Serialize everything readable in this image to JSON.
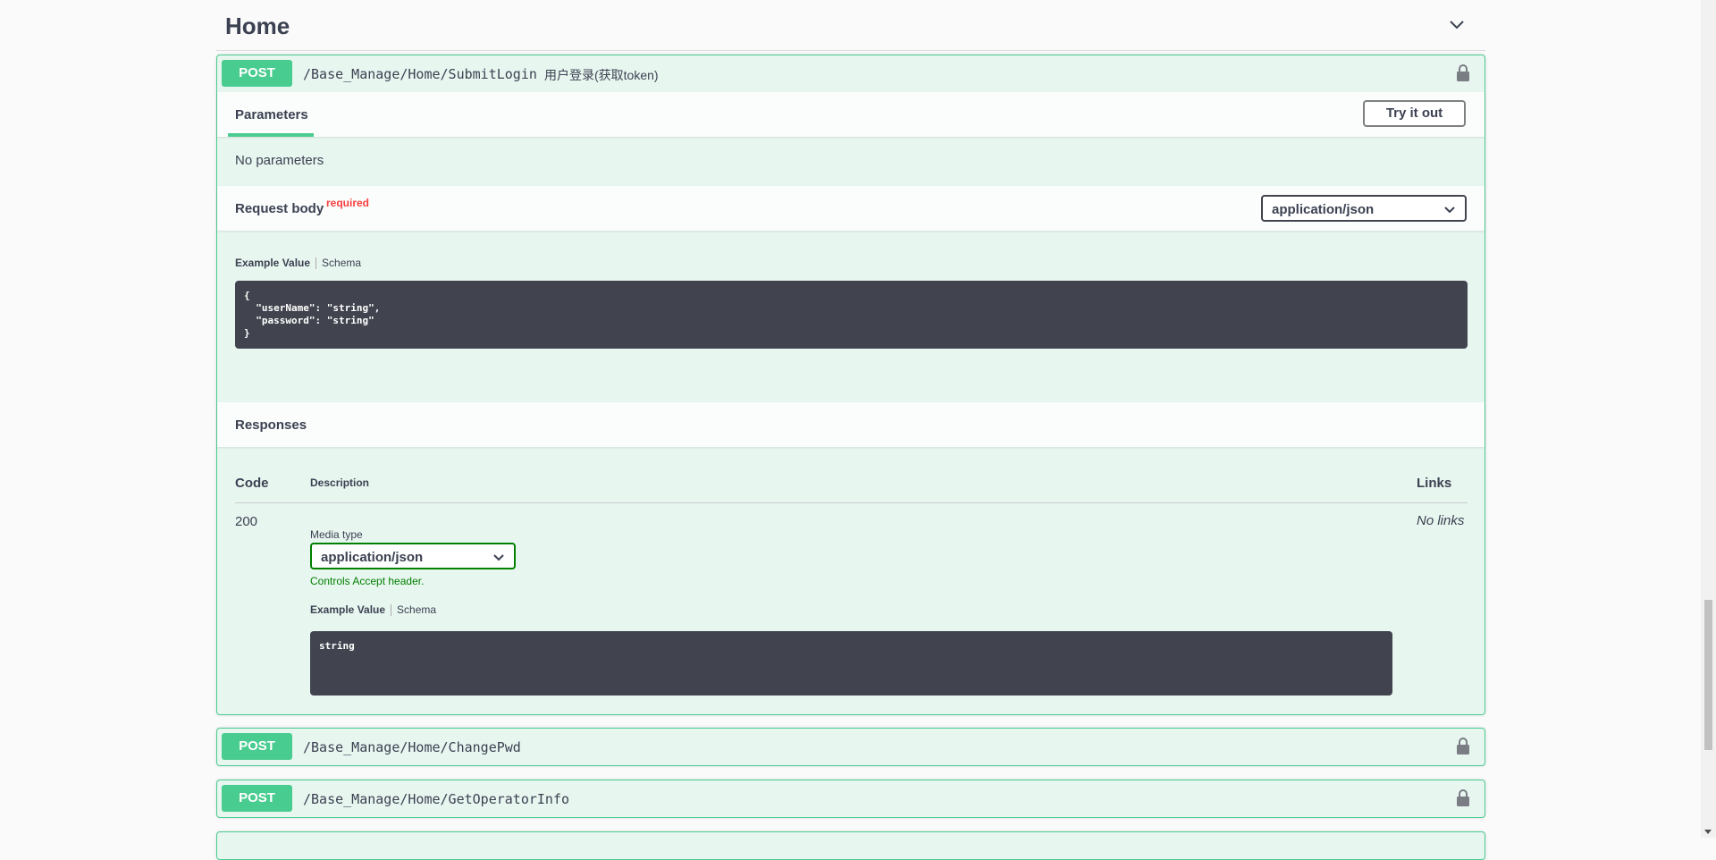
{
  "tag": {
    "title": "Home",
    "chevron_icon": "chevron-down-icon"
  },
  "operations": [
    {
      "method": "POST",
      "path": "/Base_Manage/Home/SubmitLogin",
      "summary": "用户登录(获取token)",
      "lock_icon": "lock-icon",
      "expanded": true
    },
    {
      "method": "POST",
      "path": "/Base_Manage/Home/ChangePwd",
      "summary": "",
      "lock_icon": "lock-icon",
      "expanded": false
    },
    {
      "method": "POST",
      "path": "/Base_Manage/Home/GetOperatorInfo",
      "summary": "",
      "lock_icon": "lock-icon",
      "expanded": false
    }
  ],
  "detail": {
    "parameters_tab": "Parameters",
    "try_it_out": "Try it out",
    "no_parameters": "No parameters",
    "request_body_label": "Request body",
    "required_label": "required",
    "request_content_type": "application/json",
    "example_value_tab": "Example Value",
    "schema_tab": "Schema",
    "request_example": "{\n  \"userName\": \"string\",\n  \"password\": \"string\"\n}",
    "responses_label": "Responses",
    "columns": {
      "code": "Code",
      "description": "Description",
      "links": "Links"
    },
    "responses": [
      {
        "code": "200",
        "media_type_label": "Media type",
        "media_type": "application/json",
        "controls_note": "Controls Accept header.",
        "example_value_tab": "Example Value",
        "schema_tab": "Schema",
        "example": "string",
        "links": "No links"
      }
    ]
  },
  "colors": {
    "post_green": "#49cc90",
    "post_bg": "#e8f6f0",
    "code_bg": "#41444e",
    "required_red": "#f93e3e",
    "note_green": "#008000"
  }
}
